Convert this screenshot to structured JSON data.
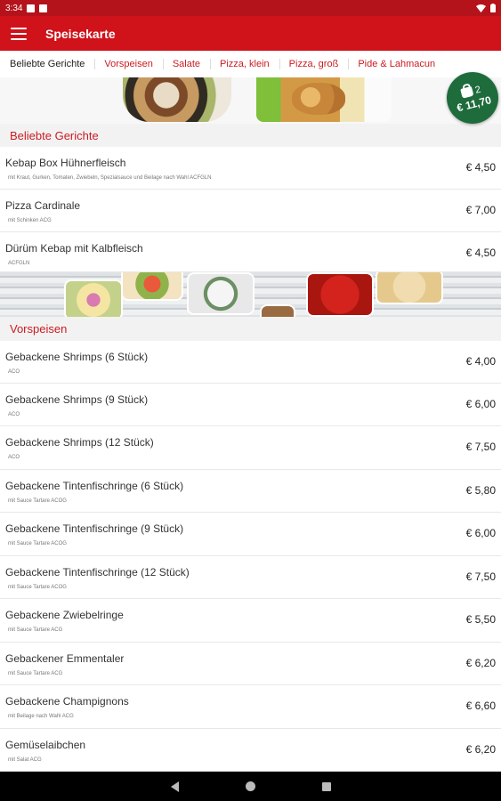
{
  "status_bar": {
    "time": "3:34",
    "icons": [
      "notification-icon",
      "notification-icon",
      "wifi-icon",
      "battery-icon"
    ]
  },
  "app_bar": {
    "title": "Speisekarte",
    "menu_icon": "hamburger-menu-icon"
  },
  "tabs": [
    {
      "label": "Beliebte Gerichte",
      "active": true
    },
    {
      "label": "Vorspeisen",
      "active": false
    },
    {
      "label": "Salate",
      "active": false
    },
    {
      "label": "Pizza, klein",
      "active": false
    },
    {
      "label": "Pizza, groß",
      "active": false
    },
    {
      "label": "Pide & Lahmacun",
      "active": false
    }
  ],
  "cart": {
    "icon": "shopping-bag-icon",
    "count": "2",
    "total": "€ 11,70",
    "color": "#1e6b3b"
  },
  "sections": [
    {
      "title": "Beliebte Gerichte",
      "items": [
        {
          "name": "Kebap Box Hühnerfleisch",
          "desc": "mit Kraut, Gurken, Tomaten, Zwiebeln, Spezialsauce und Beilage nach Wahl  ACFGLN",
          "price": "€ 4,50"
        },
        {
          "name": "Pizza Cardinale",
          "desc": "mit Schinken ACG",
          "price": "€ 7,00"
        },
        {
          "name": "Dürüm Kebap mit Kalbfleisch",
          "desc": "ACFGLN",
          "price": "€ 4,50"
        }
      ]
    },
    {
      "title": "Vorspeisen",
      "items": [
        {
          "name": "Gebackene Shrimps (6 Stück)",
          "desc": "ACO",
          "price": "€ 4,00"
        },
        {
          "name": "Gebackene Shrimps (9 Stück)",
          "desc": "ACO",
          "price": "€ 6,00"
        },
        {
          "name": "Gebackene Shrimps (12 Stück)",
          "desc": "ACO",
          "price": "€ 7,50"
        },
        {
          "name": "Gebackene Tintenfischringe (6 Stück)",
          "desc": "mit Sauce Tartare ACOG",
          "price": "€ 5,80"
        },
        {
          "name": "Gebackene Tintenfischringe (9 Stück)",
          "desc": "mit Sauce Tartare ACOG",
          "price": "€ 6,00"
        },
        {
          "name": "Gebackene Tintenfischringe (12 Stück)",
          "desc": "mit Sauce Tartare  ACOG",
          "price": "€ 7,50"
        },
        {
          "name": "Gebackene Zwiebelringe",
          "desc": "mit Sauce Tartare ACG",
          "price": "€ 5,50"
        },
        {
          "name": "Gebackener Emmentaler",
          "desc": "mit Sauce Tartare ACG",
          "price": "€ 6,20"
        },
        {
          "name": "Gebackene Champignons",
          "desc": "mit Beilage nach Wahl ACG",
          "price": "€ 6,60"
        },
        {
          "name": "Gemüselaibchen",
          "desc": "mit Salat  ACG",
          "price": "€ 6,20"
        }
      ]
    }
  ],
  "colors": {
    "status_bar": "#b5131b",
    "app_bar": "#d0121a",
    "accent": "#cc1b22",
    "background": "#f2f2f2"
  },
  "nav_bar": {
    "icons": [
      "back-icon",
      "home-icon",
      "recents-icon"
    ]
  }
}
